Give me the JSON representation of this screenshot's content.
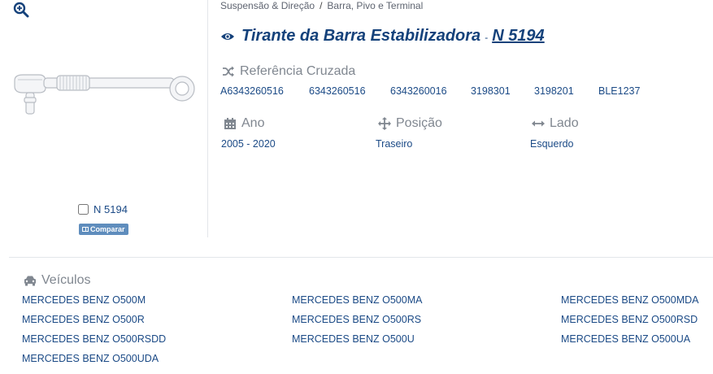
{
  "breadcrumb": {
    "items": [
      "Suspensão & Direção",
      "Barra, Pivo e Terminal"
    ],
    "separator": "/"
  },
  "product": {
    "title": "Tirante da Barra Estabilizadora",
    "title_separator": "-",
    "code": "N 5194"
  },
  "compare": {
    "checkbox_label": "N 5194",
    "button_label": "Comparar"
  },
  "cross_reference": {
    "heading": "Referência Cruzada",
    "items": [
      "A6343260516",
      "6343260516",
      "6343260016",
      "3198301",
      "3198201",
      "BLE1237"
    ]
  },
  "attributes": {
    "ano": {
      "label": "Ano",
      "value": "2005 - 2020"
    },
    "posicao": {
      "label": "Posição",
      "value": "Traseiro"
    },
    "lado": {
      "label": "Lado",
      "value": "Esquerdo"
    }
  },
  "vehicles": {
    "heading": "Veículos",
    "items": [
      "MERCEDES BENZ O500M",
      "MERCEDES BENZ O500MA",
      "MERCEDES BENZ O500MDA",
      "MERCEDES BENZ O500R",
      "MERCEDES BENZ O500RS",
      "MERCEDES BENZ O500RSD",
      "MERCEDES BENZ O500RSDD",
      "MERCEDES BENZ O500U",
      "MERCEDES BENZ O500UA",
      "MERCEDES BENZ O500UDA"
    ]
  },
  "colors": {
    "primary": "#15427b",
    "link": "#1b4a86",
    "muted": "#808790",
    "compare_button": "#5f8dbd"
  },
  "icons": {
    "zoom": "zoom-in-icon",
    "eye": "eye-icon",
    "shuffle": "shuffle-icon",
    "calendar": "calendar-icon",
    "move": "move-arrows-icon",
    "horizontal": "arrows-horizontal-icon",
    "car": "car-icon"
  }
}
